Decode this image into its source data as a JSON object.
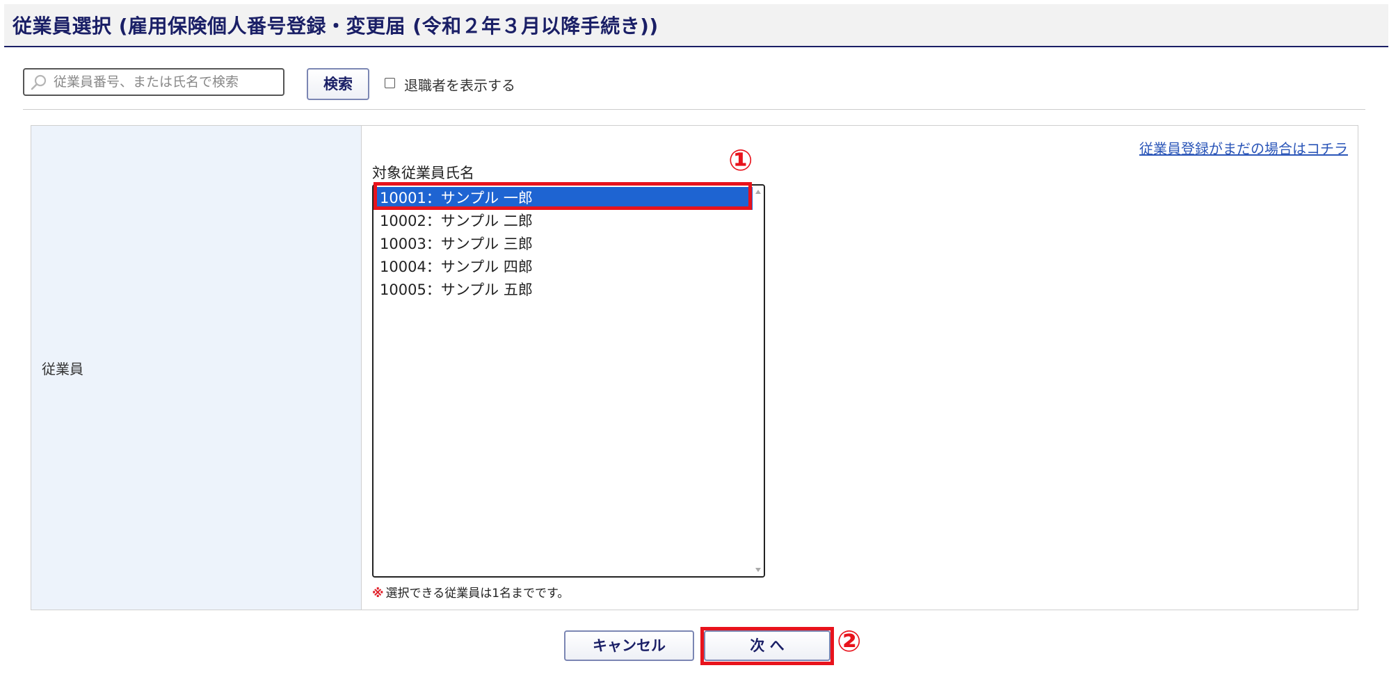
{
  "header": {
    "title": "従業員選択 (雇用保険個人番号登録・変更届 (令和２年３月以降手続き))"
  },
  "search": {
    "placeholder": "従業員番号、または氏名で検索",
    "button_label": "検索",
    "retired_label": "退職者を表示する",
    "retired_checked": false
  },
  "form": {
    "row_label": "従業員",
    "register_link": "従業員登録がまだの場合はコチラ",
    "list_label": "対象従業員氏名",
    "employees": [
      {
        "label": "10001：サンプル 一郎",
        "selected": true
      },
      {
        "label": "10002：サンプル 二郎",
        "selected": false
      },
      {
        "label": "10003：サンプル 三郎",
        "selected": false
      },
      {
        "label": "10004：サンプル 四郎",
        "selected": false
      },
      {
        "label": "10005：サンプル 五郎",
        "selected": false
      }
    ],
    "note_mark": "※",
    "note_text": "選択できる従業員は1名までです。"
  },
  "actions": {
    "cancel_label": "キャンセル",
    "next_label": "次 へ"
  },
  "annotations": {
    "step1": "①",
    "step2": "②"
  },
  "colors": {
    "accent": "#1a1f66",
    "selected_row": "#1e64d2",
    "highlight": "#e8131c",
    "label_cell_bg": "#edf3fb",
    "link": "#2a55b8"
  },
  "icons": {
    "search": "search-icon",
    "scroll_up": "chevron-up-icon",
    "scroll_down": "chevron-down-icon"
  }
}
